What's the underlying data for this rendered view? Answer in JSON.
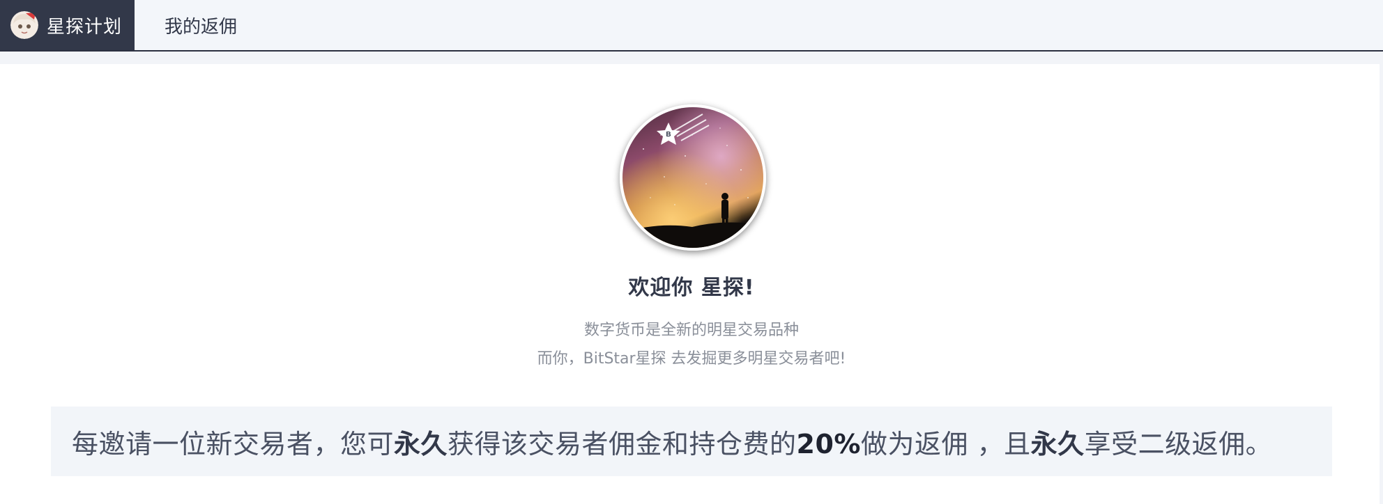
{
  "header": {
    "brand": "星探计划",
    "nav_item": "我的返佣"
  },
  "hero": {
    "badge_letter": "B",
    "welcome": "欢迎你 星探!",
    "line1": "数字货币是全新的明星交易品种",
    "line2": "而你，BitStar星探 去发掘更多明星交易者吧!"
  },
  "banner": {
    "part1": "每邀请一位新交易者，您可",
    "em1": "永久",
    "part2": "获得该交易者佣金和持仓费的",
    "pct": "20%",
    "part3": "做为返佣 ，且",
    "em2": "永久",
    "part4": "享受二级返佣。"
  },
  "colors": {
    "brand_bg": "#323849",
    "page_bg": "#f2f4f8",
    "banner_bg": "#f2f5f9",
    "muted_text": "#8a8f99"
  }
}
